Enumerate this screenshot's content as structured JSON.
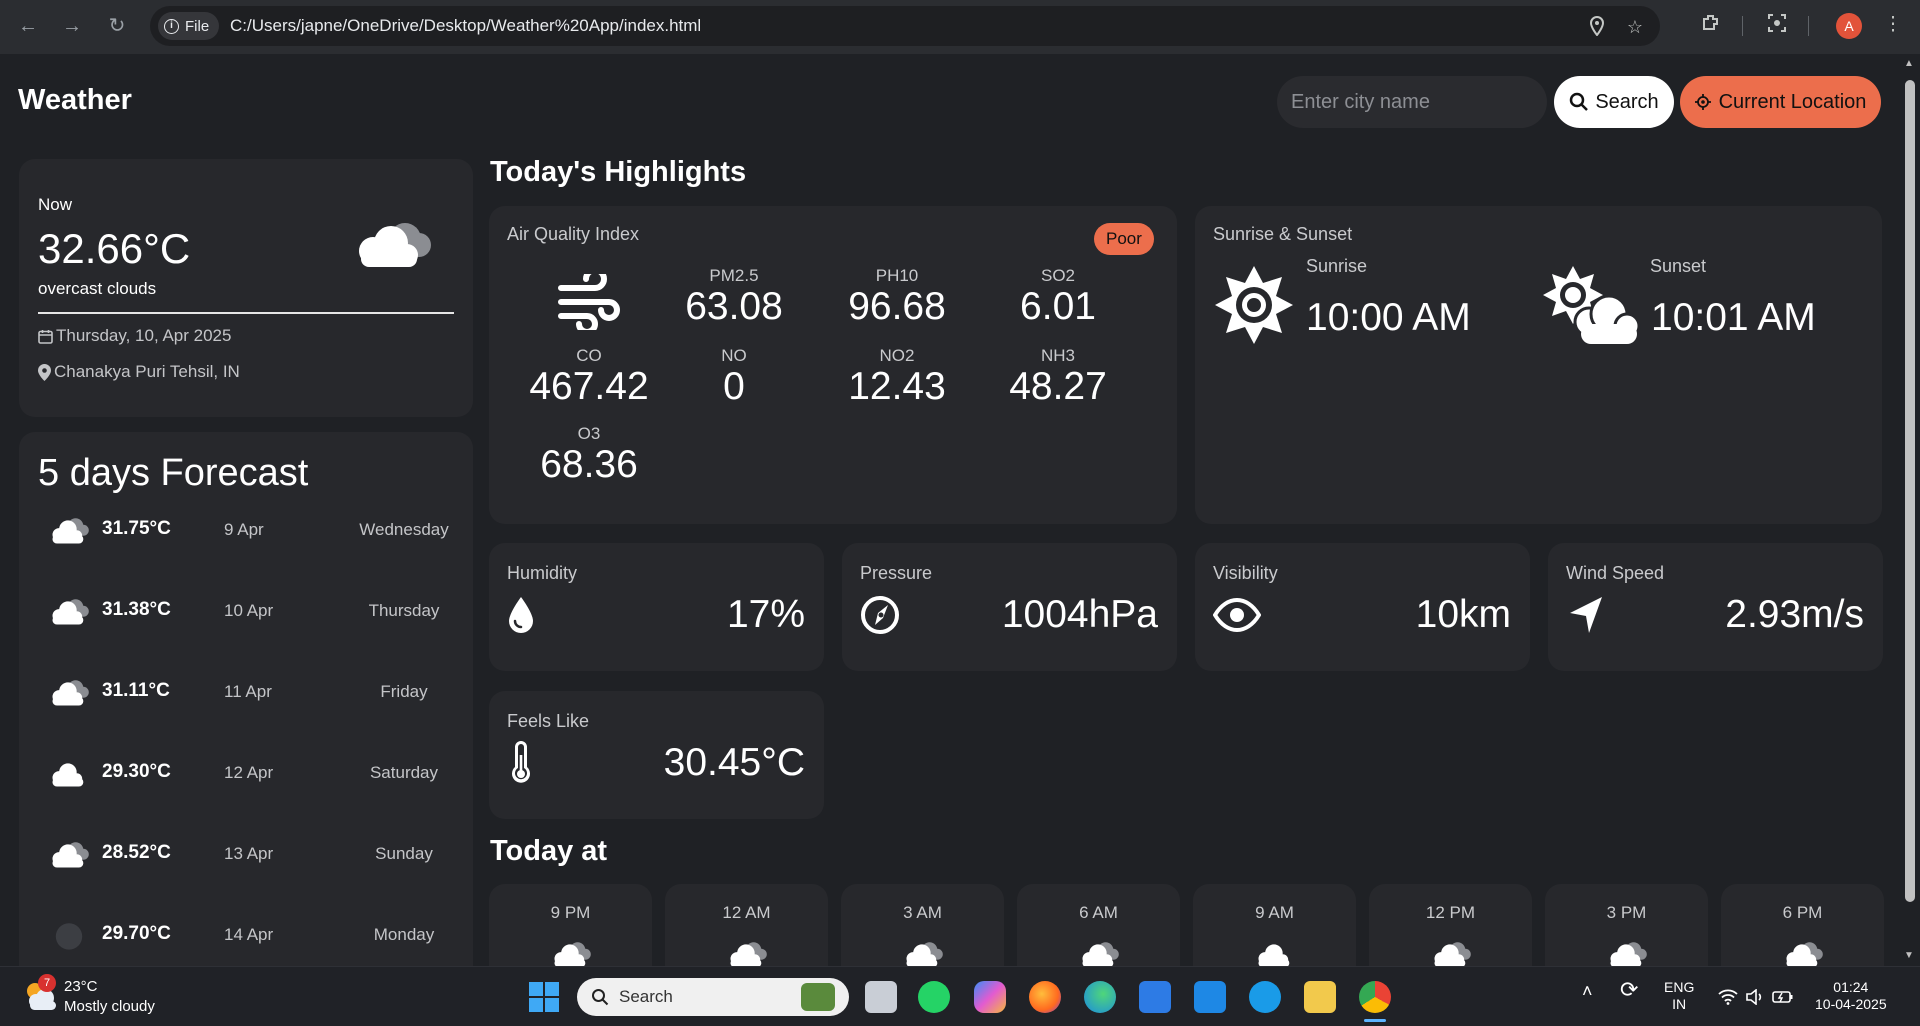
{
  "browser": {
    "file_chip": "File",
    "url": "C:/Users/japne/OneDrive/Desktop/Weather%20App/index.html",
    "profile_initial": "A"
  },
  "header": {
    "brand": "Weather",
    "search_placeholder": "Enter city name",
    "search_label": "Search",
    "location_label": "Current Location"
  },
  "current": {
    "label": "Now",
    "temp": "32.66°C",
    "description": "overcast clouds",
    "date": "Thursday, 10, Apr 2025",
    "location": "Chanakya Puri Tehsil, IN"
  },
  "forecast": {
    "title": "5 days Forecast",
    "rows": [
      {
        "temp": "31.75°C",
        "date": "9 Apr",
        "day": "Wednesday",
        "icon": "broken-clouds-icon"
      },
      {
        "temp": "31.38°C",
        "date": "10 Apr",
        "day": "Thursday",
        "icon": "broken-clouds-icon"
      },
      {
        "temp": "31.11°C",
        "date": "11 Apr",
        "day": "Friday",
        "icon": "broken-clouds-icon"
      },
      {
        "temp": "29.30°C",
        "date": "12 Apr",
        "day": "Saturday",
        "icon": "cloud-icon"
      },
      {
        "temp": "28.52°C",
        "date": "13 Apr",
        "day": "Sunday",
        "icon": "broken-clouds-icon"
      },
      {
        "temp": "29.70°C",
        "date": "14 Apr",
        "day": "Monday",
        "icon": "rain-dark-icon"
      }
    ]
  },
  "highlights": {
    "title": "Today's Highlights",
    "aqi": {
      "label": "Air Quality Index",
      "badge": "Poor",
      "items": [
        {
          "name": "PM2.5",
          "value": "63.08"
        },
        {
          "name": "PH10",
          "value": "96.68"
        },
        {
          "name": "SO2",
          "value": "6.01"
        },
        {
          "name": "CO",
          "value": "467.42"
        },
        {
          "name": "NO",
          "value": "0"
        },
        {
          "name": "NO2",
          "value": "12.43"
        },
        {
          "name": "NH3",
          "value": "48.27"
        },
        {
          "name": "O3",
          "value": "68.36"
        }
      ]
    },
    "sun": {
      "label": "Sunrise & Sunset",
      "sunrise_label": "Sunrise",
      "sunrise": "10:00 AM",
      "sunset_label": "Sunset",
      "sunset": "10:01 AM"
    },
    "humidity": {
      "label": "Humidity",
      "value": "17%"
    },
    "pressure": {
      "label": "Pressure",
      "value": "1004hPa"
    },
    "visibility": {
      "label": "Visibility",
      "value": "10km"
    },
    "wind": {
      "label": "Wind Speed",
      "value": "2.93m/s"
    },
    "feels_like": {
      "label": "Feels Like",
      "value": "30.45°C"
    }
  },
  "today": {
    "title": "Today at",
    "hours": [
      "9 PM",
      "12 AM",
      "3 AM",
      "6 AM",
      "9 AM",
      "12 PM",
      "3 PM",
      "6 PM"
    ]
  },
  "taskbar": {
    "weather_temp": "23°C",
    "weather_desc": "Mostly cloudy",
    "weather_badge": "7",
    "search_label": "Search",
    "lang_top": "ENG",
    "lang_bottom": "IN",
    "time": "01:24",
    "date": "10-04-2025"
  },
  "colors": {
    "accent": "#ec6e4c",
    "background": "#1f2125",
    "card": "#27282c"
  }
}
